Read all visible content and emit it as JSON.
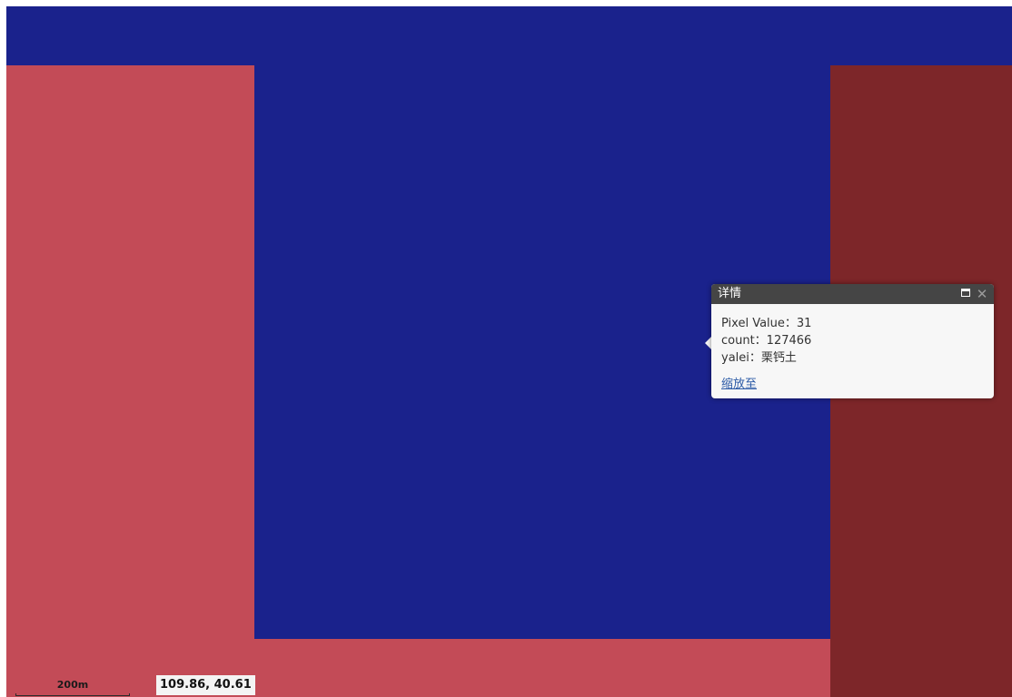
{
  "map": {
    "regions": [
      {
        "id": "top",
        "color": "#1a228c"
      },
      {
        "id": "left",
        "color": "#c34b57"
      },
      {
        "id": "center",
        "color": "#1a228c"
      },
      {
        "id": "bottom",
        "color": "#c34b57"
      },
      {
        "id": "right",
        "color": "#7d2629"
      }
    ]
  },
  "popup": {
    "title": "详情",
    "maximize_icon": "maximize-icon",
    "close_icon": "close-icon",
    "close_glyph": "✕",
    "pixel_value": "Pixel Value：31",
    "count": "count：127466",
    "yalei": "yalei：栗钙土",
    "zoom_link": "缩放至"
  },
  "scale_bar": {
    "label": "200m"
  },
  "coordinates": {
    "value": "109.86, 40.61"
  }
}
